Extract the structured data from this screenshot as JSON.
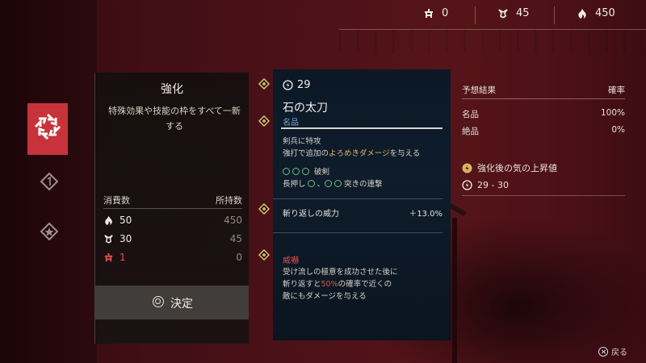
{
  "currencies": [
    {
      "icon": "shrine-icon",
      "value": "0"
    },
    {
      "icon": "spirit-icon",
      "value": "45"
    },
    {
      "icon": "flame-icon",
      "value": "450"
    }
  ],
  "menu": {
    "title": "強化",
    "description": "特殊効果や技能の枠をすべて一新する",
    "cost_header": "消費数",
    "owned_header": "所持数",
    "costs": [
      {
        "icon": "flame-icon",
        "need": "50",
        "have": "450",
        "color": "#f2ede6"
      },
      {
        "icon": "spirit-icon",
        "need": "30",
        "have": "45",
        "color": "#f2ede6"
      },
      {
        "icon": "shrine-icon",
        "need": "1",
        "have": "0",
        "color": "#e0504f"
      }
    ],
    "confirm_label": "決定"
  },
  "item": {
    "level": "29",
    "name": "石の太刀",
    "rarity": "名品",
    "effect_line1": "剣兵に特攻",
    "effect_line2_a": "強打で追加の",
    "effect_line2_gold": "よろめきダメージ",
    "effect_line2_b": "を与える",
    "skill_name": "破剣",
    "skill_line2_a": "長押し",
    "skill_line2_b": "、",
    "skill_line2_c": "突きの連撃",
    "stat_label": "斬り返しの威力",
    "stat_value": "＋13.0%",
    "trait_name": "威嚇",
    "trait_desc1": "受け流しの極意を成功させた後に",
    "trait_desc2_a": "斬り返すと",
    "trait_desc2_red": "50%",
    "trait_desc2_b": "の確率で近くの",
    "trait_desc3": "敵にもダメージを与える"
  },
  "forecast": {
    "header": "予想結果",
    "rate_header": "確率",
    "rows": [
      {
        "label": "名品",
        "value": "100%"
      },
      {
        "label": "絶品",
        "value": "0%"
      }
    ],
    "ki_label": "強化後の気の上昇値",
    "ki_range": "29 - 30"
  },
  "back_label": "戻る",
  "colors": {
    "accent": "#c8333b",
    "rarity": "#79a7df",
    "gold": "#d9b463",
    "warn": "#e0504f"
  }
}
